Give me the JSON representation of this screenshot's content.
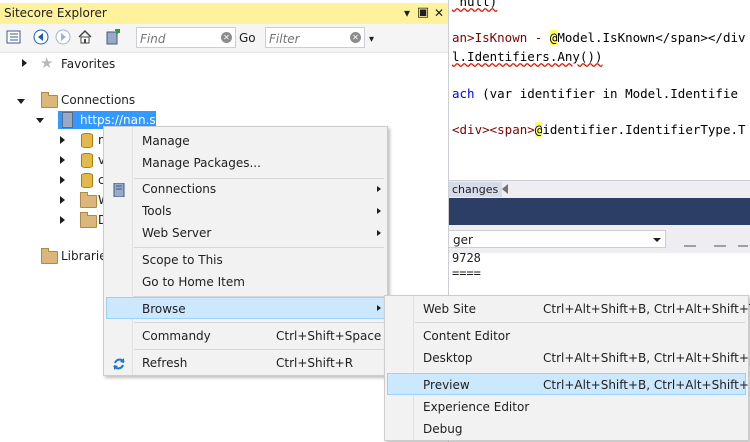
{
  "editor": {
    "line1_a": " null)",
    "line2_a": "an>IsKnown - ",
    "line2_b": "@",
    "line2_c": "Model.IsKnown</span></div",
    "line3": "l.Identifiers.Any())",
    "line4_kw": "ach",
    "line4_rest": " (var identifier in Model.Identifie",
    "line5_tag": "<div><span>",
    "line5_hl": "@",
    "line5_rest": "identifier.IdentifierType.T",
    "tab_label": "changes"
  },
  "output": {
    "combo_value": "ger",
    "line1": "9728",
    "line2": "===="
  },
  "explorer": {
    "title": "Sitecore Explorer",
    "pin_glyph": "▾",
    "close_glyph": "✕",
    "find_placeholder": "Find",
    "go_label": "Go",
    "filter_placeholder": "Filter",
    "tree": {
      "favorites": "Favorites",
      "connections": "Connections",
      "server": "https://nan.sc",
      "db1": "m",
      "db2": "v",
      "db3": "c",
      "folder1": "W",
      "folder2": "D",
      "libraries": "Libraries"
    }
  },
  "context_menu": {
    "manage": "Manage",
    "manage_packages": "Manage Packages...",
    "connections": "Connections",
    "tools": "Tools",
    "web_server": "Web Server",
    "scope": "Scope to This",
    "home": "Go to Home Item",
    "browse": "Browse",
    "commandy": "Commandy",
    "commandy_sc": "Ctrl+Shift+Space",
    "refresh": "Refresh",
    "refresh_sc": "Ctrl+Shift+R"
  },
  "browse_menu": {
    "web_site": "Web Site",
    "web_site_sc": "Ctrl+Alt+Shift+B, Ctrl+Alt+Shift+T",
    "content_editor": "Content Editor",
    "desktop": "Desktop",
    "desktop_sc": "Ctrl+Alt+Shift+B, Ctrl+Alt+Shift+E",
    "preview": "Preview",
    "preview_sc": "Ctrl+Alt+Shift+B, Ctrl+Alt+Shift+P",
    "experience_editor": "Experience Editor",
    "debug": "Debug"
  },
  "colors": {
    "title_bar": "#fff29d",
    "menu_highlight": "#cce8ff",
    "output_header": "#2d3e66"
  }
}
